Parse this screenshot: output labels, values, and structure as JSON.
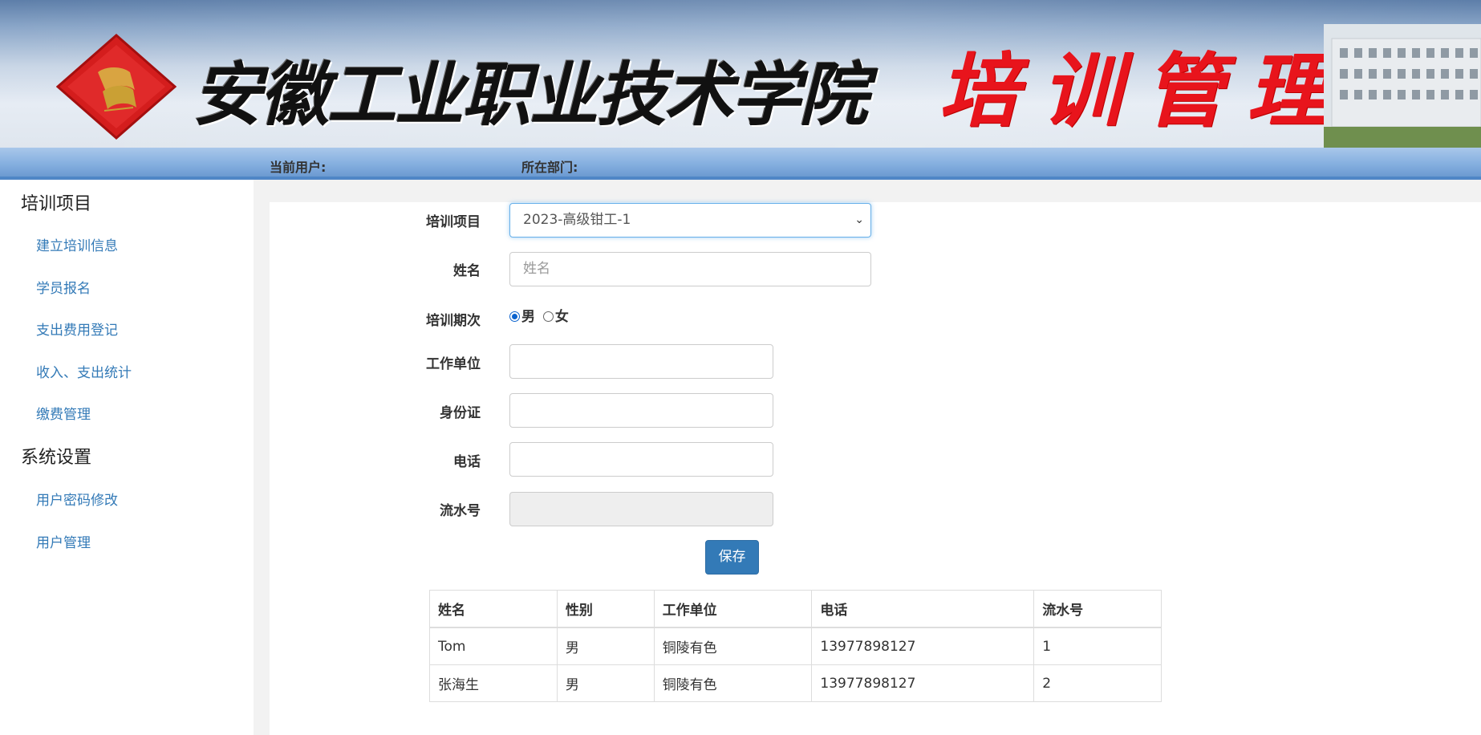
{
  "banner": {
    "school_name": "安徽工业职业技术学院",
    "system_name": "培训管理",
    "logo_icon": "school-emblem-icon"
  },
  "userbar": {
    "current_user_label": "当前用户:",
    "department_label": "所在部门:"
  },
  "sidebar": {
    "groups": [
      {
        "title": "培训项目",
        "items": [
          "建立培训信息",
          "学员报名",
          "支出费用登记",
          "收入、支出统计",
          "缴费管理"
        ]
      },
      {
        "title": "系统设置",
        "items": [
          "用户密码修改",
          "用户管理"
        ]
      }
    ]
  },
  "form": {
    "project_label": "培训项目",
    "project_value": "2023-高级钳工-1",
    "name_label": "姓名",
    "name_placeholder": "姓名",
    "period_label": "培训期次",
    "gender_male": "男",
    "gender_female": "女",
    "gender_selected": "男",
    "employer_label": "工作单位",
    "id_label": "身份证",
    "phone_label": "电话",
    "serial_label": "流水号",
    "save_label": "保存"
  },
  "table": {
    "headers": [
      "姓名",
      "性别",
      "工作单位",
      "电话",
      "流水号"
    ],
    "rows": [
      [
        "Tom",
        "男",
        "铜陵有色",
        "13977898127",
        "1"
      ],
      [
        "张海生",
        "男",
        "铜陵有色",
        "13977898127",
        "2"
      ]
    ]
  },
  "colors": {
    "accent": "#337ab7",
    "banner_title": "#e8141c",
    "userbar": "#86b0e0"
  }
}
